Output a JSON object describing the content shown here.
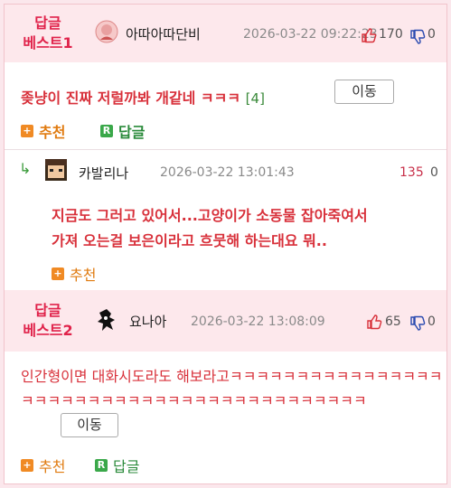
{
  "best1": {
    "badge_line1": "답글",
    "badge_line2": "베스트1",
    "nickname": "아따아따단비",
    "date": "2026-03-22 09:22:23",
    "upvotes": "170",
    "downvotes": "0",
    "content": "좆냥이 진짜 저럴까봐 개같네 ㅋㅋㅋ",
    "reply_count": "[4]",
    "move_label": "이동",
    "recommend_label": "추천",
    "reply_label": "답글"
  },
  "reply1": {
    "arrow": "↳",
    "nickname": "카발리나",
    "date": "2026-03-22 13:01:43",
    "score_up": "135",
    "score_down": "0",
    "content_line1": "지금도 그러고 있어서...고양이가 소동물 잡아죽여서",
    "content_line2": "가져 오는걸 보은이라고 흐뭇해 하는대요 뭐..",
    "recommend_label": "추천"
  },
  "best2": {
    "badge_line1": "답글",
    "badge_line2": "베스트2",
    "nickname": "요나아",
    "date": "2026-03-22 13:08:09",
    "upvotes": "65",
    "downvotes": "0",
    "content": "인간형이면 대화시도라도 해보라고ㅋㅋㅋㅋㅋㅋㅋㅋㅋㅋㅋㅋㅋㅋㅋㅋㅋㅋㅋㅋㅋㅋㅋㅋㅋㅋㅋㅋㅋㅋㅋㅋㅋㅋㅋㅋㅋㅋㅋㅋㅋㅋ",
    "move_label": "이동",
    "recommend_label": "추천",
    "reply_label": "답글"
  },
  "colors": {
    "accent_red": "#d8303a",
    "best_bg": "#fde8ec",
    "recommend_orange": "#f08a24",
    "reply_green": "#3aa84a"
  },
  "icons": {
    "up": "thumbs-up-icon",
    "down": "thumbs-down-icon",
    "plus": "plus-square-icon",
    "reply": "r-square-icon"
  }
}
